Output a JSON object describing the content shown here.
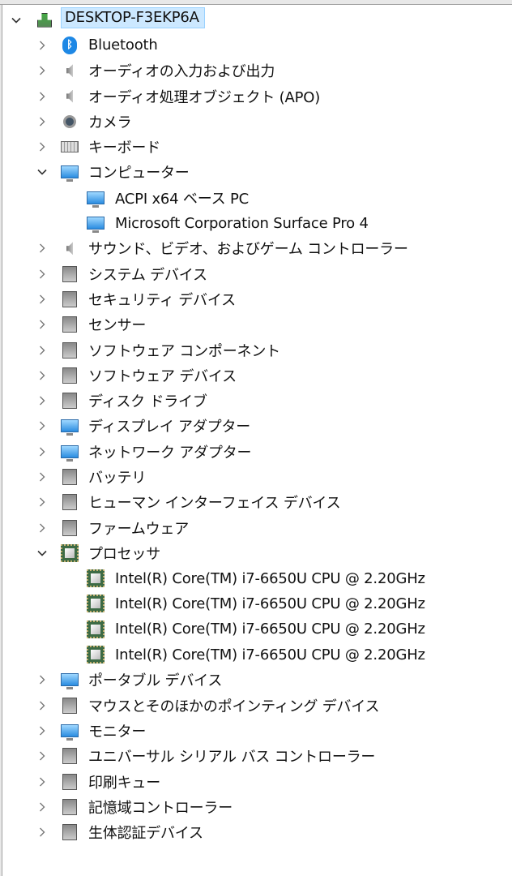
{
  "tree": [
    {
      "level": 0,
      "expanded": true,
      "icon": "computer-root-icon",
      "label": "DESKTOP-F3EKP6A"
    },
    {
      "level": 1,
      "expanded": false,
      "icon": "bluetooth-icon",
      "label": "Bluetooth"
    },
    {
      "level": 1,
      "expanded": false,
      "icon": "speaker-icon",
      "label": "オーディオの入力および出力"
    },
    {
      "level": 1,
      "expanded": false,
      "icon": "speaker-icon",
      "label": "オーディオ処理オブジェクト (APO)"
    },
    {
      "level": 1,
      "expanded": false,
      "icon": "webcam-icon",
      "label": "カメラ"
    },
    {
      "level": 1,
      "expanded": false,
      "icon": "keyboard-icon",
      "label": "キーボード"
    },
    {
      "level": 1,
      "expanded": true,
      "icon": "monitor-icon",
      "label": "コンピューター"
    },
    {
      "level": 2,
      "icon": "monitor-icon",
      "label": "ACPI x64 ベース PC"
    },
    {
      "level": 2,
      "icon": "monitor-icon",
      "label": "Microsoft Corporation Surface Pro 4"
    },
    {
      "level": 1,
      "expanded": false,
      "icon": "speaker-icon",
      "label": "サウンド、ビデオ、およびゲーム コントローラー"
    },
    {
      "level": 1,
      "expanded": false,
      "icon": "system-devices-icon",
      "label": "システム デバイス"
    },
    {
      "level": 1,
      "expanded": false,
      "icon": "security-key-icon",
      "label": "セキュリティ デバイス"
    },
    {
      "level": 1,
      "expanded": false,
      "icon": "sensor-icon",
      "label": "センサー"
    },
    {
      "level": 1,
      "expanded": false,
      "icon": "software-component-icon",
      "label": "ソフトウェア コンポーネント"
    },
    {
      "level": 1,
      "expanded": false,
      "icon": "software-device-icon",
      "label": "ソフトウェア デバイス"
    },
    {
      "level": 1,
      "expanded": false,
      "icon": "disk-drive-icon",
      "label": "ディスク ドライブ"
    },
    {
      "level": 1,
      "expanded": false,
      "icon": "display-adapter-icon",
      "label": "ディスプレイ アダプター"
    },
    {
      "level": 1,
      "expanded": false,
      "icon": "network-adapter-icon",
      "label": "ネットワーク アダプター"
    },
    {
      "level": 1,
      "expanded": false,
      "icon": "battery-icon",
      "label": "バッテリ"
    },
    {
      "level": 1,
      "expanded": false,
      "icon": "hid-icon",
      "label": "ヒューマン インターフェイス デバイス"
    },
    {
      "level": 1,
      "expanded": false,
      "icon": "firmware-icon",
      "label": "ファームウェア"
    },
    {
      "level": 1,
      "expanded": true,
      "icon": "processor-icon",
      "label": "プロセッサ"
    },
    {
      "level": 2,
      "icon": "processor-icon",
      "label": "Intel(R) Core(TM) i7-6650U CPU @ 2.20GHz"
    },
    {
      "level": 2,
      "icon": "processor-icon",
      "label": "Intel(R) Core(TM) i7-6650U CPU @ 2.20GHz"
    },
    {
      "level": 2,
      "icon": "processor-icon",
      "label": "Intel(R) Core(TM) i7-6650U CPU @ 2.20GHz"
    },
    {
      "level": 2,
      "icon": "processor-icon",
      "label": "Intel(R) Core(TM) i7-6650U CPU @ 2.20GHz"
    },
    {
      "level": 1,
      "expanded": false,
      "icon": "portable-device-icon",
      "label": "ポータブル デバイス"
    },
    {
      "level": 1,
      "expanded": false,
      "icon": "mouse-icon",
      "label": "マウスとそのほかのポインティング デバイス"
    },
    {
      "level": 1,
      "expanded": false,
      "icon": "monitor-icon",
      "label": "モニター"
    },
    {
      "level": 1,
      "expanded": false,
      "icon": "usb-icon",
      "label": "ユニバーサル シリアル バス コントローラー"
    },
    {
      "level": 1,
      "expanded": false,
      "icon": "printer-icon",
      "label": "印刷キュー"
    },
    {
      "level": 1,
      "expanded": false,
      "icon": "storage-controller-icon",
      "label": "記憶域コントローラー"
    },
    {
      "level": 1,
      "expanded": false,
      "icon": "biometric-icon",
      "label": "生体認証デバイス"
    }
  ]
}
